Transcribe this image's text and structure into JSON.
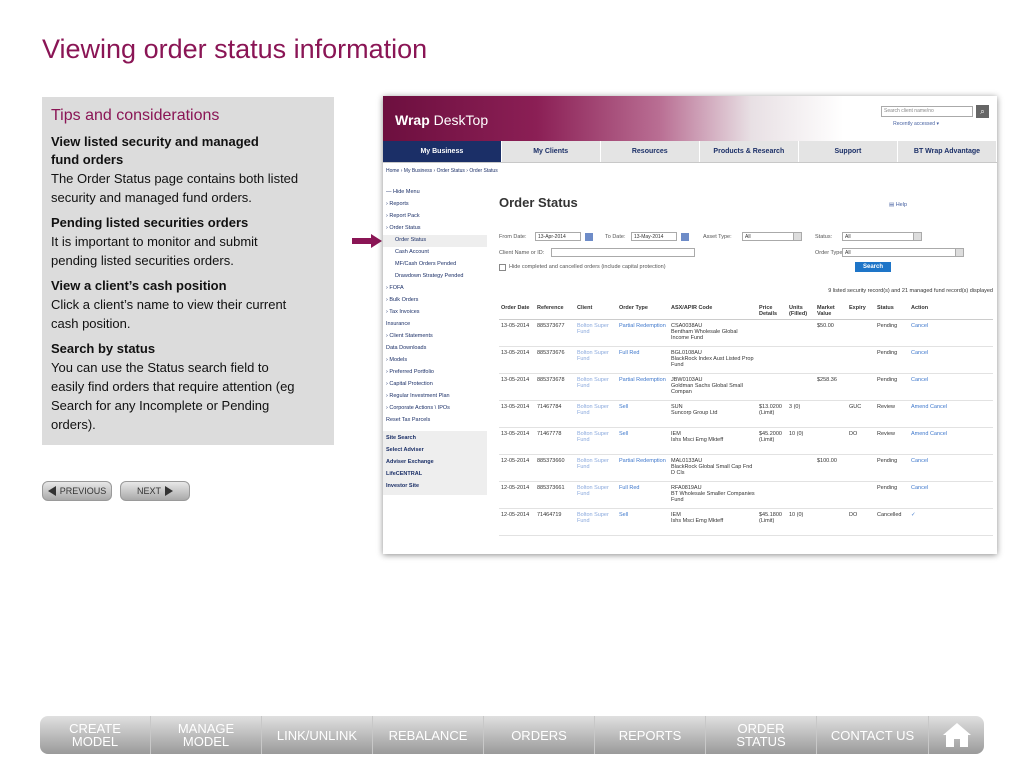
{
  "page_title": "Viewing order status information",
  "tips": {
    "heading": "Tips and considerations",
    "sections": [
      {
        "title": "View listed security and managed fund orders",
        "body": "The Order Status page contains both listed security and managed fund orders."
      },
      {
        "title": "Pending listed securities orders",
        "body": "It is important to monitor and submit pending listed securities orders."
      },
      {
        "title": "View a client’s cash position",
        "body": "Click a client’s name to view their current cash position."
      },
      {
        "title": "Search by status",
        "body": "You can use the Status search field to easily find orders that require attention (eg Search for any Incomplete or Pending orders)."
      }
    ]
  },
  "pager": {
    "previous": "PREVIOUS",
    "next": "NEXT"
  },
  "app": {
    "brand_bold": "Wrap",
    "brand_rest": " DeskTop",
    "search_placeholder": "Search client name/no",
    "recently_accessed": "Recently accessed ▾",
    "nav": [
      "My Business",
      "My Clients",
      "Resources",
      "Products & Research",
      "Support",
      "BT Wrap Advantage"
    ],
    "breadcrumb": "Home  ›  My Business  ›  Order Status  ›  Order Status",
    "sidebar": {
      "items": [
        {
          "label": "— Hide Menu",
          "sub": false
        },
        {
          "label": "› Reports",
          "sub": false
        },
        {
          "label": "› Report Pack",
          "sub": false
        },
        {
          "label": "› Order Status",
          "sub": false
        },
        {
          "label": "Order Status",
          "sub": true,
          "selected": true
        },
        {
          "label": "Cash Account",
          "sub": true
        },
        {
          "label": "MF/Cash Orders Pended",
          "sub": true
        },
        {
          "label": "Drawdown Strategy Pended",
          "sub": true
        },
        {
          "label": "› FOFA",
          "sub": false
        },
        {
          "label": "› Bulk Orders",
          "sub": false
        },
        {
          "label": "› Tax Invoices",
          "sub": false
        },
        {
          "label": "Insurance",
          "sub": false
        },
        {
          "label": "› Client Statements",
          "sub": false
        },
        {
          "label": "Data Downloads",
          "sub": false
        },
        {
          "label": "› Models",
          "sub": false
        },
        {
          "label": "› Preferred Portfolio",
          "sub": false
        },
        {
          "label": "› Capital Protection",
          "sub": false
        },
        {
          "label": "› Regular Investment Plan",
          "sub": false
        },
        {
          "label": "› Corporate Actions \\ IPOs",
          "sub": false
        },
        {
          "label": "Reset Tax Parcels",
          "sub": false
        }
      ],
      "extra": [
        "Site Search",
        "Select Adviser",
        "Adviser Exchange",
        "LifeCENTRAL",
        "Investor Site"
      ]
    },
    "content": {
      "title": "Order Status",
      "help": "Help",
      "from_date_label": "From Date:",
      "from_date": "13-Apr-2014",
      "to_date_label": "To Date:",
      "to_date": "13-May-2014",
      "asset_type_label": "Asset Type:",
      "asset_type": "All",
      "status_label": "Status:",
      "status": "All",
      "client_label": "Client Name or ID:",
      "order_type_label": "Order Type:",
      "order_type": "All",
      "hide_label": "Hide completed and cancelled orders (include capital protection)",
      "search_btn": "Search",
      "records": "9 listed security record(s) and 21 managed fund record(s) displayed",
      "columns": [
        "Order Date",
        "Reference",
        "Client",
        "Order Type",
        "ASX/APIR Code",
        "Price Details",
        "Units (Filled)",
        "Market Value",
        "Expiry",
        "Status",
        "Action"
      ],
      "rows": [
        {
          "date": "13-05-2014",
          "ref": "885373677",
          "client": "Bolton Super Fund",
          "type": "Partial Redemption",
          "code": "CSA0038AU",
          "desc": "Bentham Wholesale Global Income Fund",
          "price": "",
          "units": "",
          "mv": "$50.00",
          "expiry": "",
          "status": "Pending",
          "action": "Cancel"
        },
        {
          "date": "13-05-2014",
          "ref": "885373676",
          "client": "Bolton Super Fund",
          "type": "Full Red",
          "code": "BGL0108AU",
          "desc": "BlackRock Index Aust Listed Prop Fund",
          "price": "",
          "units": "",
          "mv": "",
          "expiry": "",
          "status": "Pending",
          "action": "Cancel"
        },
        {
          "date": "13-05-2014",
          "ref": "885373678",
          "client": "Bolton Super Fund",
          "type": "Partial Redemption",
          "code": "JBW0103AU",
          "desc": "Goldman Sachs Global Small Compan",
          "price": "",
          "units": "",
          "mv": "$258.36",
          "expiry": "",
          "status": "Pending",
          "action": "Cancel"
        },
        {
          "date": "13-05-2014",
          "ref": "71467784",
          "client": "Bolton Super Fund",
          "type": "Sell",
          "code": "SUN",
          "desc": "Suncorp Group Ltd",
          "price": "$13.0200 (Limit)",
          "units": "3 (0)",
          "mv": "",
          "expiry": "GUC",
          "status": "Review",
          "action": "Amend Cancel"
        },
        {
          "date": "13-05-2014",
          "ref": "71467778",
          "client": "Bolton Super Fund",
          "type": "Sell",
          "code": "IEM",
          "desc": "Ishs Msci Emg Mkteff",
          "price": "$45.2000 (Limit)",
          "units": "10 (0)",
          "mv": "",
          "expiry": "DO",
          "status": "Review",
          "action": "Amend Cancel"
        },
        {
          "date": "12-05-2014",
          "ref": "885373660",
          "client": "Bolton Super Fund",
          "type": "Partial Redemption",
          "code": "MAL0133AU",
          "desc": "BlackRock Global Small Cap Fnd D Cls",
          "price": "",
          "units": "",
          "mv": "$100.00",
          "expiry": "",
          "status": "Pending",
          "action": "Cancel"
        },
        {
          "date": "12-05-2014",
          "ref": "885373661",
          "client": "Bolton Super Fund",
          "type": "Full Red",
          "code": "RFA0819AU",
          "desc": "BT Wholesale Smaller Companies Fund",
          "price": "",
          "units": "",
          "mv": "",
          "expiry": "",
          "status": "Pending",
          "action": "Cancel"
        },
        {
          "date": "12-05-2014",
          "ref": "71464719",
          "client": "Bolton Super Fund",
          "type": "Sell",
          "code": "IEM",
          "desc": "Ishs Msci Emg Mkteff",
          "price": "$45.1800 (Limit)",
          "units": "10 (0)",
          "mv": "",
          "expiry": "DO",
          "status": "Cancelled",
          "action": "✓"
        }
      ]
    }
  },
  "bottom_nav": [
    "CREATE MODEL",
    "MANAGE MODEL",
    "LINK/UNLINK",
    "REBALANCE",
    "ORDERS",
    "REPORTS",
    "ORDER STATUS",
    "CONTACT US"
  ],
  "colors": {
    "accent": "#8a1555",
    "app_navy": "#1b2f67",
    "pointer": "#8a1555"
  }
}
